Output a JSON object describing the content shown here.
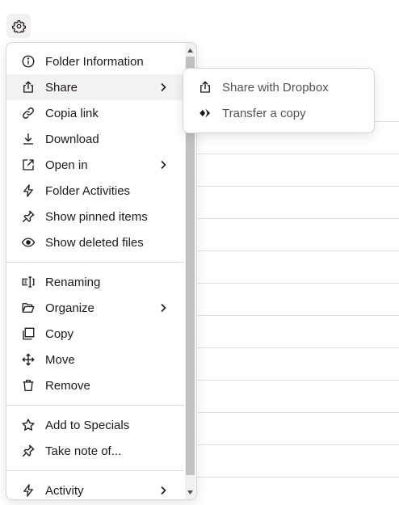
{
  "menu": {
    "items": [
      {
        "label": "Folder Information",
        "icon": "info-icon"
      },
      {
        "label": "Share",
        "icon": "share-icon",
        "submenu": true,
        "active": true
      },
      {
        "label": "Copia link",
        "icon": "link-icon"
      },
      {
        "label": "Download",
        "icon": "download-icon"
      },
      {
        "label": "Open in",
        "icon": "open-external-icon",
        "submenu": true
      },
      {
        "label": "Folder Activities",
        "icon": "lightning-icon"
      },
      {
        "label": "Show pinned items",
        "icon": "pin-icon"
      },
      {
        "label": "Show deleted files",
        "icon": "eye-icon"
      },
      {
        "label": "Renaming",
        "icon": "rename-icon"
      },
      {
        "label": "Organize",
        "icon": "folder-icon",
        "submenu": true
      },
      {
        "label": "Copy",
        "icon": "copy-icon"
      },
      {
        "label": "Move",
        "icon": "move-icon"
      },
      {
        "label": "Remove",
        "icon": "trash-icon"
      },
      {
        "label": "Add to Specials",
        "icon": "star-icon"
      },
      {
        "label": "Take note of...",
        "icon": "pin-icon"
      },
      {
        "label": "Activity",
        "icon": "lightning-icon",
        "submenu": true
      }
    ]
  },
  "submenu": {
    "items": [
      {
        "label": "Share with Dropbox",
        "icon": "share-icon"
      },
      {
        "label": "Transfer a copy",
        "icon": "transfer-icon"
      }
    ]
  },
  "colors": {
    "text": "#1e1919",
    "submenu_text": "#52524f",
    "active_bg": "#f3f2f0",
    "border": "#d8d6d2",
    "scrollbar_thumb": "#c1c1c1"
  }
}
